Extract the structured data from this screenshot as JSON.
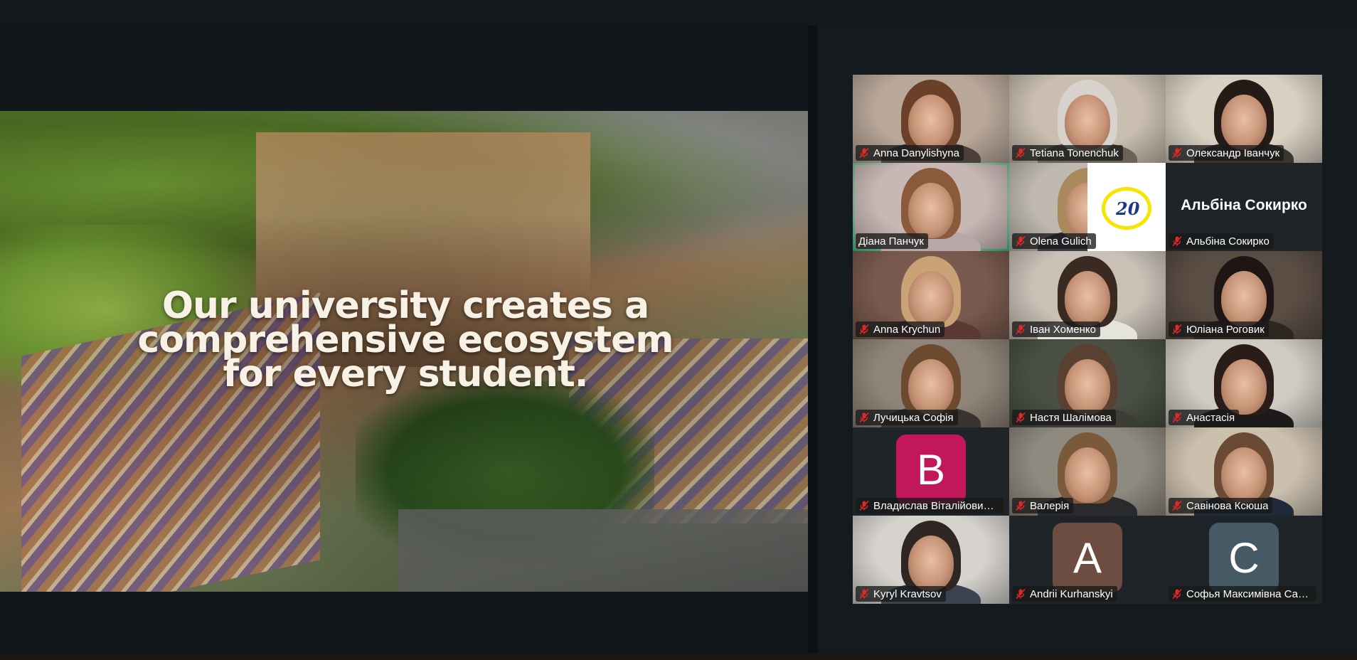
{
  "slide": {
    "headline": "Our university creates a comprehensive ecosystem for every student."
  },
  "gallery": {
    "participants": [
      {
        "name": "Anna Danylishyna",
        "muted": true,
        "type": "video",
        "bg": "#b9a89a",
        "hair": "#6b4028",
        "clothing": "#4a3f3a",
        "speaking": false
      },
      {
        "name": "Tetiana Tonenchuk",
        "muted": true,
        "type": "video",
        "bg": "#c9beb0",
        "hair": "#d8d2cc",
        "clothing": "#6b6358",
        "speaking": false
      },
      {
        "name": "Олександр Іванчук",
        "muted": true,
        "type": "video",
        "bg": "#d8d0c2",
        "hair": "#241a16",
        "clothing": "#3a3430",
        "speaking": false
      },
      {
        "name": "Діана Панчук",
        "muted": false,
        "type": "video",
        "bg": "#c8b8b5",
        "hair": "#8b5a3c",
        "clothing": "#b7a8a8",
        "speaking": true
      },
      {
        "name": "Olena Gulich",
        "muted": true,
        "type": "video-logo",
        "bg": "#bfb9b0",
        "hair": "#a88a5c",
        "clothing": "#3c3c46",
        "logo_text": "20",
        "speaking": false
      },
      {
        "name": "Альбіна Сокирко",
        "muted": true,
        "type": "name",
        "display_name": "Альбіна Сокирко",
        "bg": "#1f2428",
        "speaking": false
      },
      {
        "name": "Anna Krychun",
        "muted": true,
        "type": "video",
        "bg": "#7a5a4e",
        "hair": "#c9a276",
        "clothing": "#5c3a34",
        "speaking": false
      },
      {
        "name": "Іван Хоменко",
        "muted": true,
        "type": "video",
        "bg": "#c9c1b6",
        "hair": "#3a2a22",
        "clothing": "#e6e2dc",
        "speaking": false
      },
      {
        "name": "Юліана Роговик",
        "muted": true,
        "type": "video",
        "bg": "#5a4d44",
        "hair": "#1e1614",
        "clothing": "#2e2620",
        "speaking": false
      },
      {
        "name": "Лучицька Софія",
        "muted": true,
        "type": "video",
        "bg": "#8f8478",
        "hair": "#6b4a30",
        "clothing": "#3a3430",
        "speaking": false
      },
      {
        "name": "Настя Шалімова",
        "muted": true,
        "type": "video",
        "bg": "#4a5044",
        "hair": "#5a4030",
        "clothing": "#3c3e36",
        "speaking": false
      },
      {
        "name": "Анастасія",
        "muted": true,
        "type": "video",
        "bg": "#cfcac2",
        "hair": "#2a1c18",
        "clothing": "#1c1a1a",
        "speaking": false
      },
      {
        "name": "Владислав Віталійович К...",
        "muted": true,
        "type": "avatar",
        "letter": "B",
        "avatar_color": "#c2185b",
        "bg": "#1f2428",
        "speaking": false
      },
      {
        "name": "Валерія",
        "muted": true,
        "type": "video",
        "bg": "#8f8a80",
        "hair": "#7a5a3a",
        "clothing": "#2a2a2c",
        "speaking": false
      },
      {
        "name": "Савінова Ксюша",
        "muted": true,
        "type": "video",
        "bg": "#cbbfae",
        "hair": "#6a4a34",
        "clothing": "#1f2a3a",
        "speaking": false
      },
      {
        "name": "Kyryl Kravtsov",
        "muted": true,
        "type": "video",
        "bg": "#d6d3cf",
        "hair": "#2e2622",
        "clothing": "#3a4450",
        "speaking": false
      },
      {
        "name": "Andrii Kurhanskyi",
        "muted": true,
        "type": "avatar",
        "letter": "A",
        "avatar_color": "#6d4c41",
        "bg": "#1f2428",
        "speaking": false
      },
      {
        "name": "Софья Максимівна Савч...",
        "muted": true,
        "type": "avatar",
        "letter": "C",
        "avatar_color": "#455a64",
        "bg": "#1f2428",
        "speaking": false
      }
    ]
  },
  "colors": {
    "active_speaker": "#23d98b",
    "muted_mic": "#e02828",
    "window_bg": "#12171b"
  },
  "icons": {
    "mic": "muted-mic-icon"
  }
}
